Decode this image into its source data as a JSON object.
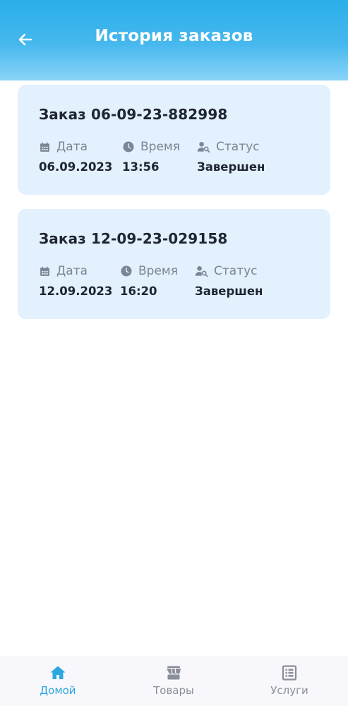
{
  "header": {
    "title": "История заказов",
    "back_icon": "arrow-left-icon"
  },
  "labels": {
    "date": "Дата",
    "time": "Время",
    "status": "Статус"
  },
  "orders": [
    {
      "title": "Заказ 06-09-23-882998",
      "date": "06.09.2023",
      "time": "13:56",
      "status": "Завершен"
    },
    {
      "title": "Заказ 12-09-23-029158",
      "date": "12.09.2023",
      "time": "16:20",
      "status": "Завершен"
    }
  ],
  "bottom_nav": {
    "items": [
      {
        "label": "Домой",
        "icon": "home-icon",
        "active": true
      },
      {
        "label": "Товары",
        "icon": "store-icon",
        "active": false
      },
      {
        "label": "Услуги",
        "icon": "list-icon",
        "active": false
      }
    ]
  },
  "colors": {
    "header_gradient_top": "#2aaee9",
    "header_gradient_bottom": "#8ad4f8",
    "card_background": "#e3f0fd",
    "active_nav": "#2aa7e0",
    "inactive_nav": "#8a8f99"
  }
}
